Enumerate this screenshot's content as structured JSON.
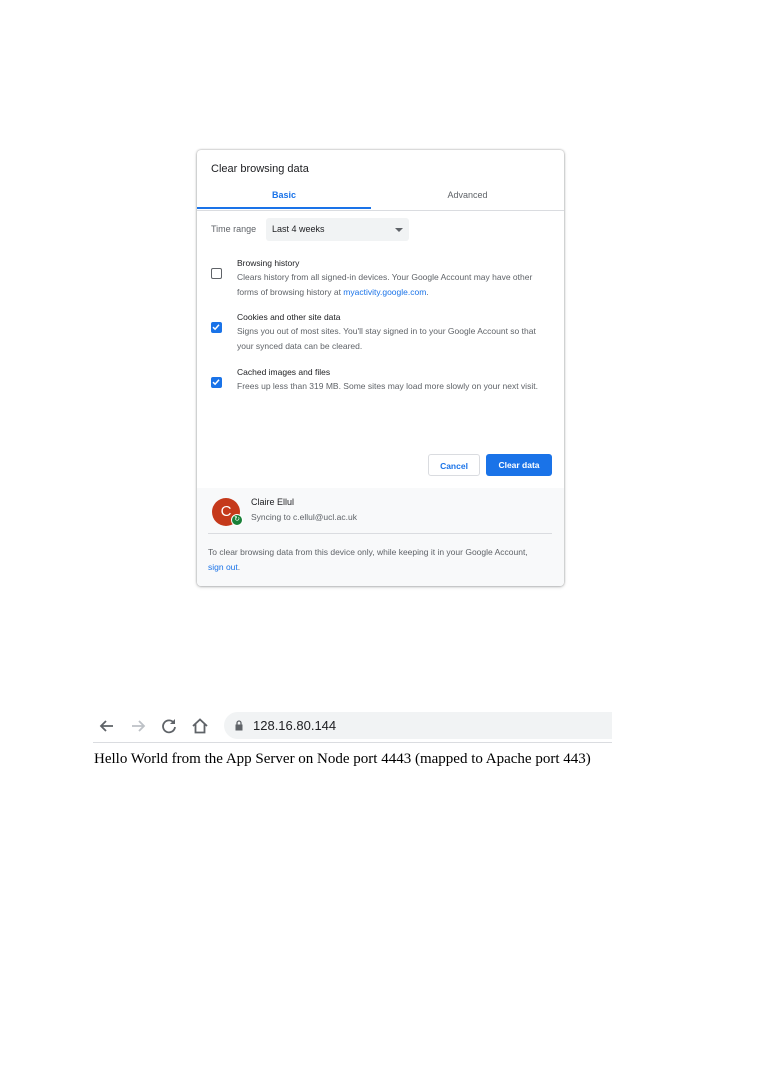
{
  "dialog": {
    "title": "Clear browsing data",
    "tabs": [
      {
        "label": "Basic",
        "active": true
      },
      {
        "label": "Advanced",
        "active": false
      }
    ],
    "time_range": {
      "label": "Time range",
      "value": "Last 4 weeks"
    },
    "options": [
      {
        "title": "Browsing history",
        "desc": "Clears history from all signed-in devices. Your Google Account may have other forms of browsing history at ",
        "link": "myactivity.google.com",
        "desc_end": ".",
        "checked": false
      },
      {
        "title": "Cookies and other site data",
        "desc": "Signs you out of most sites. You'll stay signed in to your Google Account so that your synced data can be cleared.",
        "checked": true
      },
      {
        "title": "Cached images and files",
        "desc": "Frees up less than 319 MB. Some sites may load more slowly on your next visit.",
        "checked": true
      }
    ],
    "buttons": {
      "cancel": "Cancel",
      "clear": "Clear data"
    },
    "account": {
      "initial": "C",
      "name": "Claire Ellul",
      "sync": "Syncing to c.ellul@ucl.ac.uk"
    },
    "footer": {
      "text": "To clear browsing data from this device only, while keeping it in your Google Account, ",
      "link": "sign out",
      "text_end": "."
    },
    "colors": {
      "accent": "#1a73e8",
      "avatar": "#c5391b",
      "sync_badge": "#188038"
    }
  },
  "browser": {
    "icons": [
      "back-arrow-icon",
      "forward-arrow-icon",
      "reload-icon",
      "home-icon",
      "lock-icon"
    ],
    "url": "128.16.80.144",
    "page_text": "Hello World from the App Server on Node port 4443 (mapped to Apache port 443)"
  }
}
